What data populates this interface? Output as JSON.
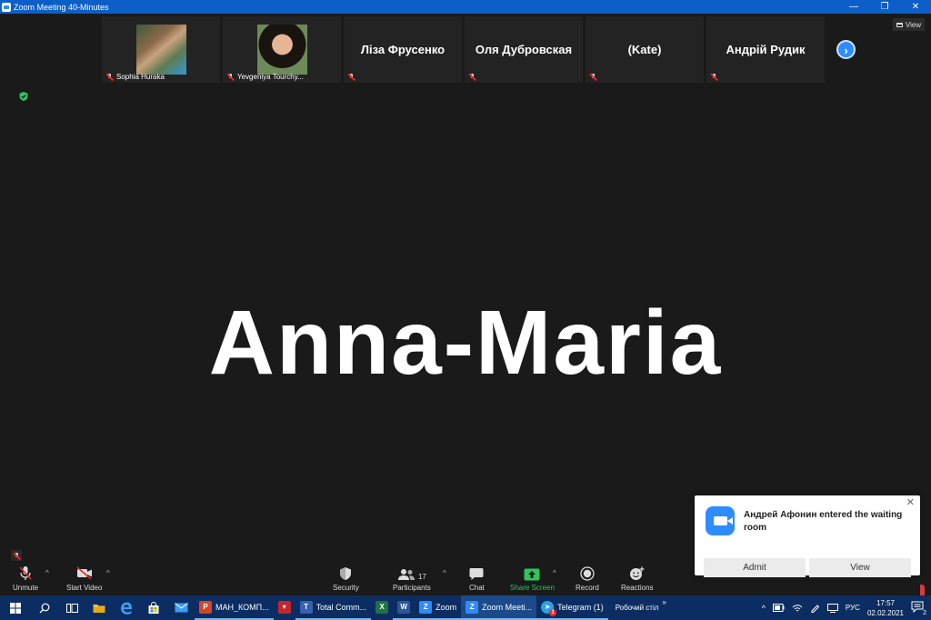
{
  "window": {
    "title": "Zoom Meeting 40-Minutes",
    "view_label": "View"
  },
  "participants_strip": [
    {
      "name": "Sophia Huraka",
      "video": true,
      "muted": true
    },
    {
      "name": "Yevgeniya Tourchy...",
      "video": true,
      "muted": true
    },
    {
      "name": "Ліза Фрусенко",
      "video": false,
      "muted": true
    },
    {
      "name": "Оля Дубровская",
      "video": false,
      "muted": true
    },
    {
      "name": "(Kate)",
      "video": false,
      "muted": true
    },
    {
      "name": "Андрій Рудик",
      "video": false,
      "muted": true
    }
  ],
  "active_speaker": {
    "name": "Anna-Maria"
  },
  "toolbar": {
    "unmute": "Unmute",
    "start_video": "Start Video",
    "security": "Security",
    "participants": "Participants",
    "participants_count": "17",
    "chat": "Chat",
    "share_screen": "Share Screen",
    "record": "Record",
    "reactions": "Reactions"
  },
  "notification": {
    "message": "Андрей Афонин entered the waiting room",
    "admit": "Admit",
    "view": "View"
  },
  "taskbar": {
    "apps": [
      {
        "label": "МАН_КОМП...",
        "color": "#d24726",
        "glyph": "P"
      },
      {
        "label": "",
        "color": "#c4262e",
        "glyph": "▾"
      },
      {
        "label": "Total Comm...",
        "color": "#3a5fb0",
        "glyph": "T"
      },
      {
        "label": "",
        "color": "#1f7244",
        "glyph": "X"
      },
      {
        "label": "",
        "color": "#2b579a",
        "glyph": "W"
      },
      {
        "label": "Zoom",
        "color": "#2d8cff",
        "glyph": "Z"
      },
      {
        "label": "Zoom Meeti...",
        "color": "#2d8cff",
        "glyph": "Z"
      },
      {
        "label": "Telegram (1)",
        "color": "#2aa3df",
        "glyph": "➤",
        "badge": "1"
      }
    ],
    "desktop_label": "Робочий стіл",
    "language": "РУС",
    "time": "17:57",
    "date": "02.02.2021",
    "notifications_count": "2"
  }
}
